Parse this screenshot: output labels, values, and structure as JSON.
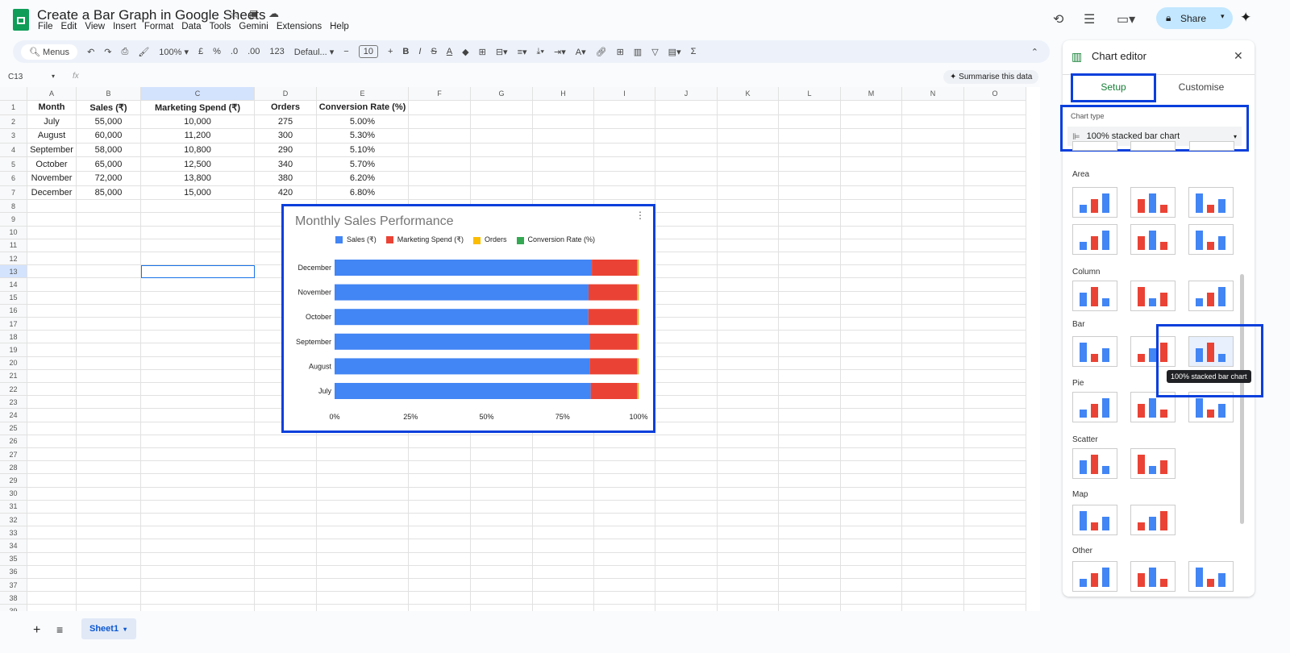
{
  "app": {
    "title": "Create a Bar Graph in Google Sheets",
    "menu": [
      "File",
      "Edit",
      "View",
      "Insert",
      "Format",
      "Data",
      "Tools",
      "Gemini",
      "Extensions",
      "Help"
    ],
    "share": "Share"
  },
  "toolbar": {
    "menus": "Menus",
    "zoom": "100%",
    "currency": "£",
    "percent": "%",
    "dec_less": ".0",
    "dec_more": ".00",
    "number_format": "123",
    "font": "Defaul...",
    "font_size": "10"
  },
  "formula_bar": {
    "cell_ref": "C13",
    "fx": "fx"
  },
  "summarise": "Summarise this data",
  "sheet": {
    "columns": [
      "A",
      "B",
      "C",
      "D",
      "E",
      "F",
      "G",
      "H",
      "I",
      "J",
      "K",
      "L",
      "M",
      "N",
      "O"
    ],
    "row_count": 39,
    "selected": "C13",
    "rows": [
      [
        "Month",
        "Sales (₹)",
        "Marketing Spend (₹)",
        "Orders",
        "Conversion Rate (%)"
      ],
      [
        "July",
        "55,000",
        "10,000",
        "275",
        "5.00%"
      ],
      [
        "August",
        "60,000",
        "11,200",
        "300",
        "5.30%"
      ],
      [
        "September",
        "58,000",
        "10,800",
        "290",
        "5.10%"
      ],
      [
        "October",
        "65,000",
        "12,500",
        "340",
        "5.70%"
      ],
      [
        "November",
        "72,000",
        "13,800",
        "380",
        "6.20%"
      ],
      [
        "December",
        "85,000",
        "15,000",
        "420",
        "6.80%"
      ]
    ]
  },
  "chart_data": {
    "type": "bar",
    "stacking": "100%",
    "orientation": "horizontal",
    "title": "Monthly Sales Performance",
    "categories": [
      "December",
      "November",
      "October",
      "September",
      "August",
      "July"
    ],
    "series": [
      {
        "name": "Sales (₹)",
        "color": "#4285f4",
        "values": [
          85000,
          72000,
          65000,
          58000,
          60000,
          55000
        ]
      },
      {
        "name": "Marketing Spend (₹)",
        "color": "#ea4335",
        "values": [
          15000,
          13800,
          12500,
          10800,
          11200,
          10000
        ]
      },
      {
        "name": "Orders",
        "color": "#fbbc04",
        "values": [
          420,
          380,
          340,
          290,
          300,
          275
        ]
      },
      {
        "name": "Conversion Rate (%)",
        "color": "#34a853",
        "values": [
          6.8,
          6.2,
          5.7,
          5.1,
          5.3,
          5.0
        ]
      }
    ],
    "xticks": [
      "0%",
      "25%",
      "50%",
      "75%",
      "100%"
    ],
    "legend": "top"
  },
  "editor": {
    "title": "Chart editor",
    "tabs": [
      "Setup",
      "Customise"
    ],
    "chart_type_label": "Chart type",
    "chart_type": "100% stacked bar chart",
    "sections": [
      "Area",
      "Column",
      "Bar",
      "Pie",
      "Scatter",
      "Map",
      "Other"
    ],
    "tooltip": "100% stacked bar chart"
  },
  "bottom": {
    "sheet_tab": "Sheet1"
  }
}
